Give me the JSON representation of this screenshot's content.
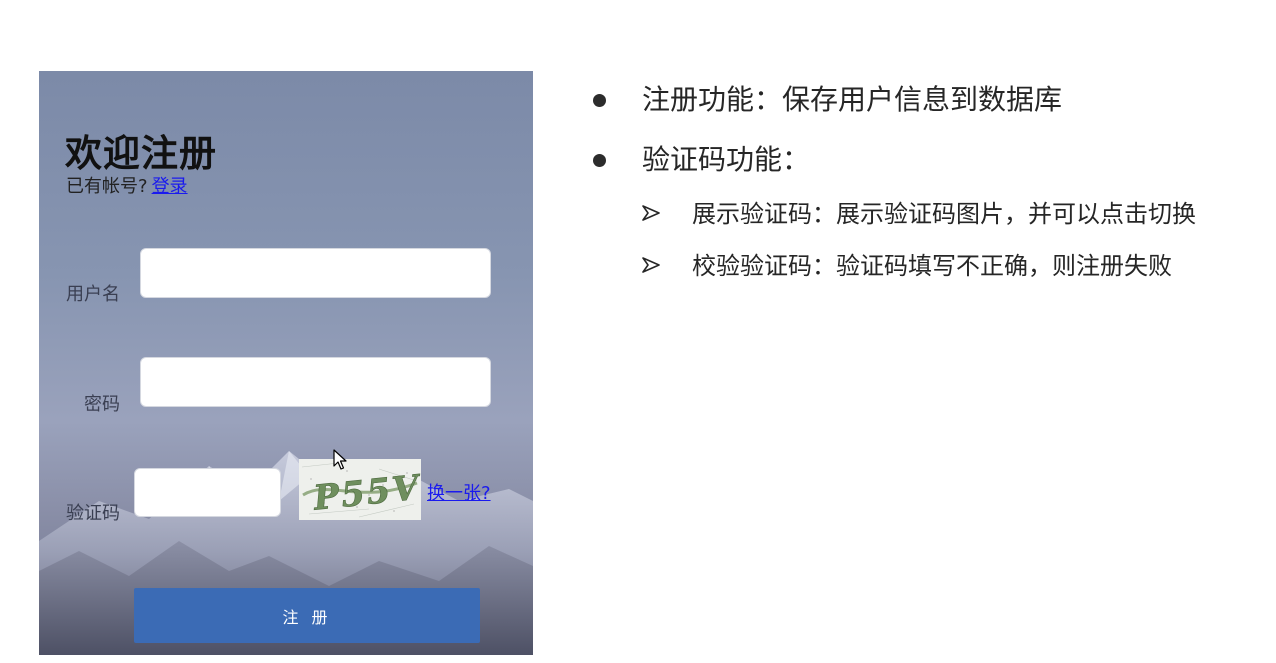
{
  "form": {
    "title": "欢迎注册",
    "has_account_text": "已有帐号?",
    "login_link": "登录",
    "username_label": "用户名",
    "username_value": "",
    "password_label": "密码",
    "password_value": "",
    "captcha_label": "验证码",
    "captcha_value": "",
    "captcha_image_text": "P55V",
    "change_captcha_link": "换一张?",
    "submit_label": "注 册"
  },
  "notes": {
    "bullets": [
      {
        "text": "注册功能：保存用户信息到数据库"
      },
      {
        "text": "验证码功能："
      }
    ],
    "sub_bullets": [
      {
        "text": "展示验证码：展示验证码图片，并可以点击切换"
      },
      {
        "text": "校验验证码：验证码填写不正确，则注册失败"
      }
    ]
  },
  "colors": {
    "accent_button": "#3b6bb5",
    "link": "#1a1aee"
  }
}
